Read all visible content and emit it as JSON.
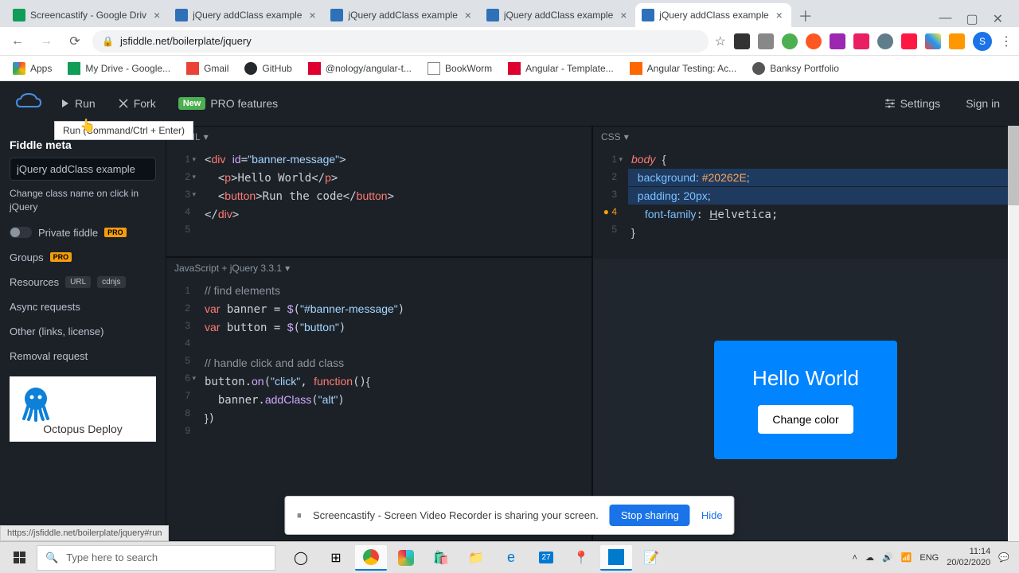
{
  "browser": {
    "tabs": [
      {
        "title": "Screencastify - Google Driv",
        "favicon": "#0f9d58"
      },
      {
        "title": "jQuery addClass example",
        "favicon": "#2e71b8"
      },
      {
        "title": "jQuery addClass example",
        "favicon": "#2e71b8"
      },
      {
        "title": "jQuery addClass example",
        "favicon": "#2e71b8"
      },
      {
        "title": "jQuery addClass example",
        "favicon": "#2e71b8",
        "active": true
      }
    ],
    "url": "jsfiddle.net/boilerplate/jquery",
    "avatar_letter": "S",
    "bookmarks": [
      {
        "label": "Apps",
        "color": "#5f6368"
      },
      {
        "label": "My Drive - Google...",
        "color": "#0f9d58"
      },
      {
        "label": "Gmail",
        "color": "#ea4335"
      },
      {
        "label": "GitHub",
        "color": "#24292e"
      },
      {
        "label": "@nology/angular-t...",
        "color": "#dd0031"
      },
      {
        "label": "BookWorm",
        "color": "#5f6368"
      },
      {
        "label": "Angular - Template...",
        "color": "#dd0031"
      },
      {
        "label": "Angular Testing: Ac...",
        "color": "#ff6600"
      },
      {
        "label": "Banksy Portfolio",
        "color": "#5f6368"
      }
    ]
  },
  "jsfiddle": {
    "toolbar": {
      "run": "Run",
      "fork": "Fork",
      "new_badge": "New",
      "pro_features": "PRO features",
      "settings": "Settings",
      "signin": "Sign in",
      "run_tooltip": "Run (Command/Ctrl + Enter)"
    },
    "sidebar": {
      "meta_heading": "Fiddle meta",
      "title_value": "jQuery addClass example",
      "description": "Change class name on click in jQuery",
      "private_label": "Private fiddle",
      "groups": "Groups",
      "resources": "Resources",
      "url_pill": "URL",
      "cdnjs_pill": "cdnjs",
      "async": "Async requests",
      "other": "Other (links, license)",
      "removal": "Removal request",
      "ad_text": "Octopus Deploy"
    },
    "panes": {
      "html_label": "HTML",
      "css_label": "CSS",
      "js_label": "JavaScript + jQuery 3.3.1"
    },
    "html_code": {
      "l1": "<div id=\"banner-message\">",
      "l2": "  <p>Hello World</p>",
      "l3": "  <button>Run the code</button>",
      "l4": "</div>"
    },
    "css_code": {
      "l1": "body {",
      "l2": "  background: #20262E;",
      "l3": "  padding: 20px;",
      "l4": "  font-family: Helvetica;",
      "l5": "}"
    },
    "js_code": {
      "l1": "// find elements",
      "l2": "var banner = $(\"#banner-message\")",
      "l3": "var button = $(\"button\")",
      "l4": "",
      "l5": "// handle click and add class",
      "l6": "button.on(\"click\", function(){",
      "l7": "  banner.addClass(\"alt\")",
      "l8": "})"
    },
    "result": {
      "heading": "Hello World",
      "button": "Change color"
    }
  },
  "share": {
    "message": "Screencastify - Screen Video Recorder is sharing your screen.",
    "stop": "Stop sharing",
    "hide": "Hide"
  },
  "status_link": "https://jsfiddle.net/boilerplate/jquery#run",
  "taskbar": {
    "search_placeholder": "Type here to search",
    "calendar_badge": "27",
    "lang": "ENG",
    "time": "11:14",
    "date": "20/02/2020"
  }
}
